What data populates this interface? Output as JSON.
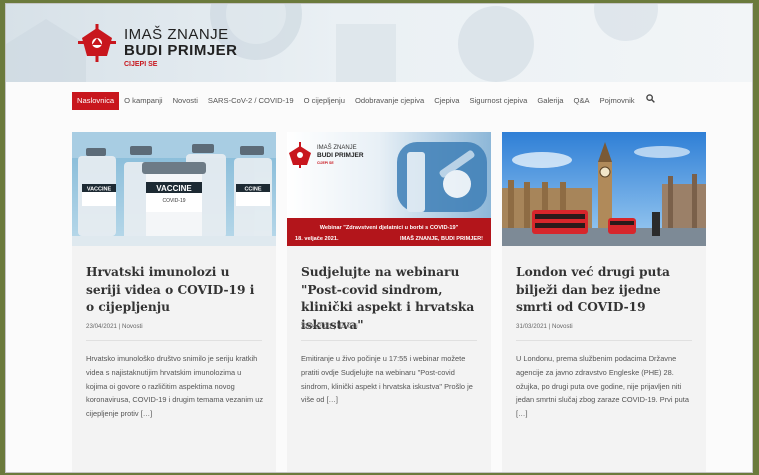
{
  "brand": {
    "line1": "IMAŠ ZNANJE",
    "line2": "BUDI PRIMJER",
    "tagline": "CIJEPI SE"
  },
  "nav": {
    "items": [
      "Naslovnica",
      "O kampanji",
      "Novosti",
      "SARS-CoV-2 / COVID-19",
      "O cijepljenju",
      "Odobravanje cjepiva",
      "Cjepiva",
      "Sigurnost cjepiva",
      "Galerija",
      "Q&A",
      "Pojmovnik"
    ],
    "active_index": 0,
    "search_icon": "search-icon"
  },
  "colors": {
    "accent": "#c8161d",
    "header_bg": "#dfe7ed",
    "card_bg": "#f3f3f3"
  },
  "posts": [
    {
      "title": "Hrvatski imunolozi u seriji videa o COVID-19 i o cijepljenju",
      "date": "23/04/2021",
      "category": "Novosti",
      "excerpt": "Hrvatsko imunološko društvo snimilo je seriju kratkih videa s najistaknutijim hrvatskim imunolozima u kojima oi govore o različitim aspektima novog koronavirusa, COVID-19 i drugim temama vezanim uz cijepljenje protiv […]",
      "image_text": {
        "vial_labels": [
          "VACCINE",
          "VACCINE",
          "CCINE"
        ],
        "vial_sub": "COVID-19"
      }
    },
    {
      "title": "Sudjelujte na webinaru \"Post-covid sindrom, klinički aspekt i hrvatska iskustva\"",
      "date": "22/04/2021",
      "category": "Novosti",
      "excerpt": "Emitiranje u živo počinje u 17:55 i webinar možete pratiti ovdje Sudjelujte na webinaru \"Post-covid sindrom, klinički aspekt i hrvatska iskustva\" Prošlo je više od […]",
      "image_text": {
        "brand1": "IMAŠ ZNANJE",
        "brand2": "BUDI PRIMJER",
        "brand3": "CIJEPI SE",
        "banner1": "Webinar \"Zdravstveni djelatnici u borbi s COVID-19\"",
        "banner2_left": "18. veljače 2021.",
        "banner2_right": "IMAŠ ZNANJE, BUDI PRIMJER!"
      }
    },
    {
      "title": "London već drugi puta bilježi dan bez ijedne smrti od COVID-19",
      "date": "31/03/2021",
      "category": "Novosti",
      "excerpt": "U Londonu, prema službenim podacima Državne agencije za javno zdravstvo Engleske (PHE) 28. ožujka, po drugi puta ove godine, nije prijavljen niti jedan smrtni slučaj zbog zaraze COVID-19. Prvi puta […]"
    }
  ]
}
